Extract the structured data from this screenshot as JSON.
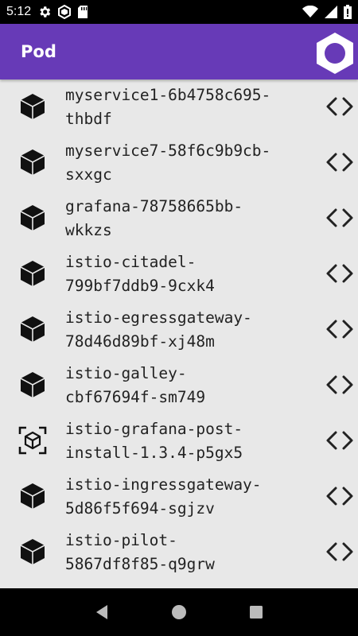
{
  "status_bar": {
    "time": "5:12",
    "icons": [
      "gear-icon",
      "hexagon-icon",
      "sd-card-icon",
      "wifi-icon",
      "signal-icon",
      "battery-icon"
    ]
  },
  "app_bar": {
    "title": "Pod",
    "background_color": "#673ab7",
    "logo_icon": "hexagon-logo-icon"
  },
  "pods": [
    {
      "name": "myservice1-6b4758c695-\nthbdf",
      "icon": "cube-solid-icon"
    },
    {
      "name": "myservice7-58f6c9b9cb-\nsxxgc",
      "icon": "cube-solid-icon"
    },
    {
      "name": "grafana-78758665bb-\nwkkzs",
      "icon": "cube-solid-icon"
    },
    {
      "name": "istio-citadel-\n799bf7ddb9-9cxk4",
      "icon": "cube-solid-icon"
    },
    {
      "name": "istio-egressgateway-\n78d46d89bf-xj48m",
      "icon": "cube-solid-icon"
    },
    {
      "name": "istio-galley-\ncbf67694f-sm749",
      "icon": "cube-solid-icon"
    },
    {
      "name": "istio-grafana-post-\ninstall-1.3.4-p5gx5",
      "icon": "cube-outline-icon"
    },
    {
      "name": "istio-ingressgateway-\n5d86f5f694-sgjzv",
      "icon": "cube-solid-icon"
    },
    {
      "name": "istio-pilot-\n5867df8f85-q9grw",
      "icon": "cube-solid-icon"
    }
  ],
  "nav_bar": {
    "icons": [
      "back-icon",
      "home-icon",
      "recents-icon"
    ]
  }
}
